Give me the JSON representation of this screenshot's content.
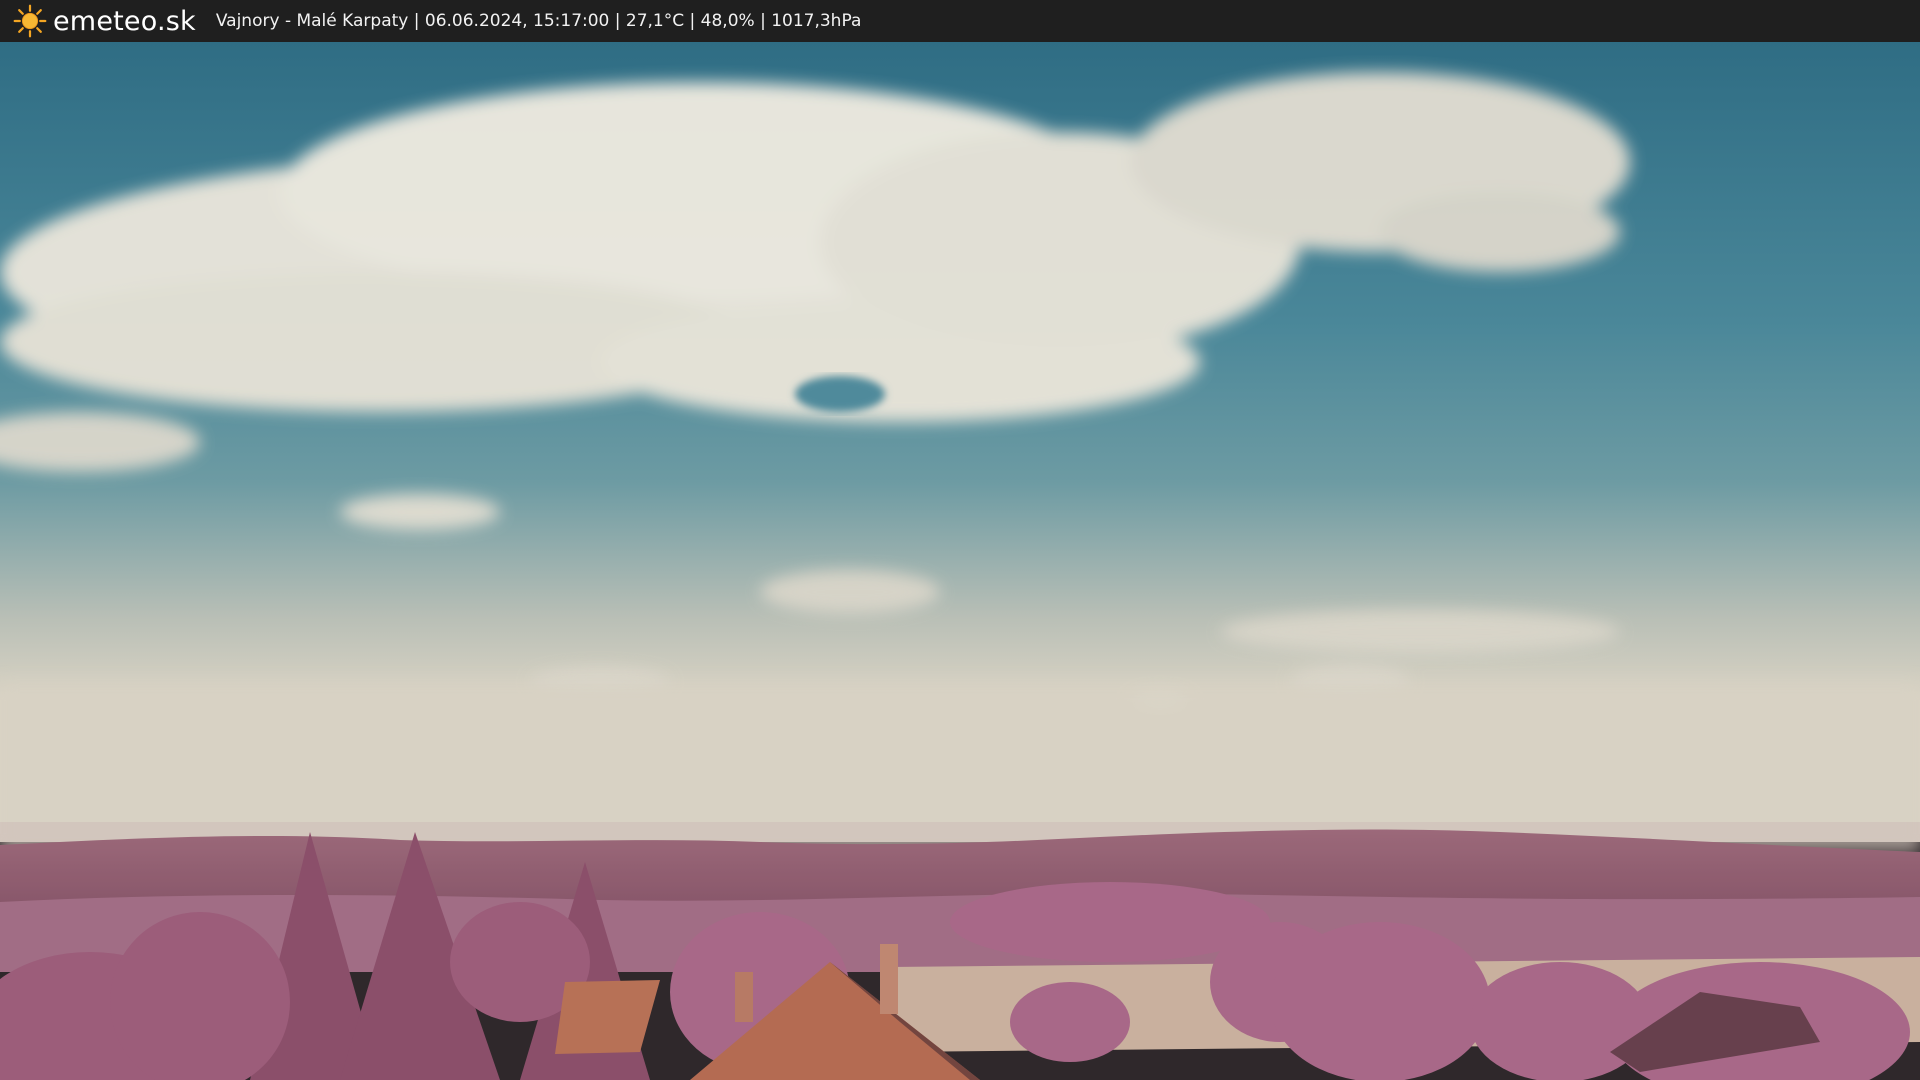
{
  "header": {
    "brand": "emeteo.sk",
    "caption": "Vajnory - Malé Karpaty | 06.06.2024, 15:17:00 | 27,1°C | 48,0% | 1017,3hPa",
    "logo_icon": "sun-icon"
  },
  "colors": {
    "bar_background": "#1f1f1f",
    "sun": "#f5a623",
    "sky_top": "#3f7e93",
    "sky_horizon": "#d7d2c4",
    "foliage": "#9c5c78",
    "hills": "#8a5868",
    "field": "#cdb8a0",
    "roof": "#b56a4a"
  }
}
